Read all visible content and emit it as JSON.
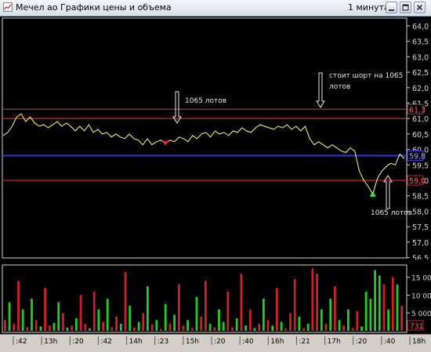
{
  "window": {
    "title": "Мечел ао Графики цены и объема",
    "interval": "1 минута",
    "buttons": [
      "minimize",
      "maximize",
      "close"
    ]
  },
  "colors": {
    "background": "#000000",
    "price_line": "#ffff66",
    "resistance_line": "#cc2222",
    "support_line": "#2233cc",
    "volume_up": "#22cc22",
    "volume_down": "#cc2222"
  },
  "price_axis": {
    "ticks": [
      "64,0",
      "63,5",
      "63,0",
      "62,5",
      "62,0",
      "61,5",
      "61,0",
      "60,5",
      "60,0",
      "59,5",
      "59,0",
      "58,5",
      "58,0",
      "57,5",
      "57,0",
      "56,5"
    ],
    "markers": [
      {
        "label": "61,3",
        "value": 61.3,
        "color": "#cc2222"
      },
      {
        "label": "59,8",
        "value": 59.8,
        "color": "#3344dd"
      },
      {
        "label": "59,0",
        "value": 59.0,
        "color": "#cc2222"
      }
    ]
  },
  "levels": [
    {
      "value": 61.3,
      "color": "#cc2222"
    },
    {
      "value": 61.0,
      "color": "#cc2222"
    },
    {
      "value": 59.8,
      "color": "#2233cc"
    },
    {
      "value": 59.0,
      "color": "#cc2222"
    }
  ],
  "annotations": {
    "buy_label": "1065 лотов",
    "short_label_line1": "стоит шорт на 1065",
    "short_label_line2": "лотов",
    "sell_label": "1065 лотов"
  },
  "volume_axis": {
    "ticks": [
      "15 000",
      "10 000",
      "5 000"
    ],
    "marker": "731"
  },
  "time_axis": {
    "labels": [
      ":42",
      "13h",
      ":20",
      ":42",
      "14h",
      ":23",
      "15h",
      ":20",
      ":40",
      "16h",
      ":21",
      "17h",
      ":20",
      ":40",
      "18h"
    ]
  },
  "chart_data": {
    "type": "line",
    "title": "",
    "xlabel": "",
    "ylabel": "",
    "ylim": [
      56.1,
      64.3
    ],
    "series": [
      {
        "values": [
          60.45,
          60.55,
          60.75,
          61.05,
          61.15,
          60.9,
          61.05,
          60.85,
          60.75,
          60.8,
          60.7,
          60.8,
          60.9,
          60.75,
          60.85,
          60.75,
          60.6,
          60.75,
          60.6,
          60.8,
          60.55,
          60.65,
          60.5,
          60.55,
          60.4,
          60.5,
          60.4,
          60.35,
          60.5,
          60.35,
          60.3,
          60.15,
          60.35,
          60.15,
          60.25,
          60.3,
          60.2,
          60.3,
          60.25,
          60.4,
          60.35,
          60.25,
          60.45,
          60.35,
          60.5,
          60.55,
          60.4,
          60.6,
          60.5,
          60.55,
          60.45,
          60.6,
          60.55,
          60.7,
          60.6,
          60.55,
          60.7,
          60.8,
          60.75,
          60.7,
          60.65,
          60.75,
          60.7,
          60.8,
          60.65,
          60.75,
          60.6,
          60.75,
          60.35,
          60.15,
          60.25,
          60.15,
          60.05,
          60.15,
          60.05,
          59.95,
          59.9,
          60.05,
          59.95,
          59.3,
          59.0,
          58.8,
          58.55,
          59.05,
          59.3,
          59.45,
          59.55,
          59.5,
          59.85,
          59.7
        ]
      }
    ],
    "volume": {
      "ylim": [
        0,
        18000
      ],
      "values": [
        3000,
        8000,
        2000,
        14000,
        6000,
        1000,
        9000,
        3000,
        1200,
        12000,
        1500,
        2200,
        8000,
        5000,
        900,
        1500,
        3500,
        10000,
        2000,
        700,
        11000,
        6000,
        2500,
        9000,
        1000,
        4000,
        2000,
        16500,
        7000,
        900,
        2500,
        5000,
        12500,
        1800,
        3000,
        500,
        7500,
        2000,
        4500,
        13000,
        1500,
        3000,
        800,
        9500,
        4000,
        14000,
        2000,
        1000,
        6000,
        2500,
        11000,
        900,
        3500,
        16000,
        1500,
        6000,
        800,
        2000,
        9000,
        3000,
        1500,
        12000,
        2500,
        700,
        5000,
        14500,
        4000,
        800,
        2000,
        17500,
        16000,
        6000,
        2000,
        9000,
        12500,
        3000,
        1500,
        6000,
        800,
        5500,
        1200,
        11000,
        9000,
        17000,
        15500,
        13000,
        6000,
        15000,
        13000,
        7000
      ],
      "directions": [
        "d",
        "u",
        "d",
        "d",
        "u",
        "d",
        "u",
        "d",
        "u",
        "d",
        "d",
        "u",
        "u",
        "d",
        "u",
        "d",
        "u",
        "d",
        "d",
        "u",
        "d",
        "u",
        "d",
        "u",
        "d",
        "d",
        "u",
        "d",
        "u",
        "d",
        "u",
        "d",
        "u",
        "d",
        "u",
        "d",
        "u",
        "d",
        "u",
        "d",
        "d",
        "u",
        "d",
        "u",
        "d",
        "d",
        "u",
        "d",
        "u",
        "u",
        "d",
        "d",
        "u",
        "d",
        "u",
        "d",
        "u",
        "d",
        "u",
        "d",
        "u",
        "d",
        "u",
        "d",
        "d",
        "d",
        "u",
        "d",
        "u",
        "d",
        "d",
        "u",
        "d",
        "u",
        "d",
        "u",
        "d",
        "u",
        "d",
        "d",
        "u",
        "u",
        "u",
        "u",
        "u",
        "d",
        "u",
        "d",
        "u",
        "d"
      ]
    }
  }
}
